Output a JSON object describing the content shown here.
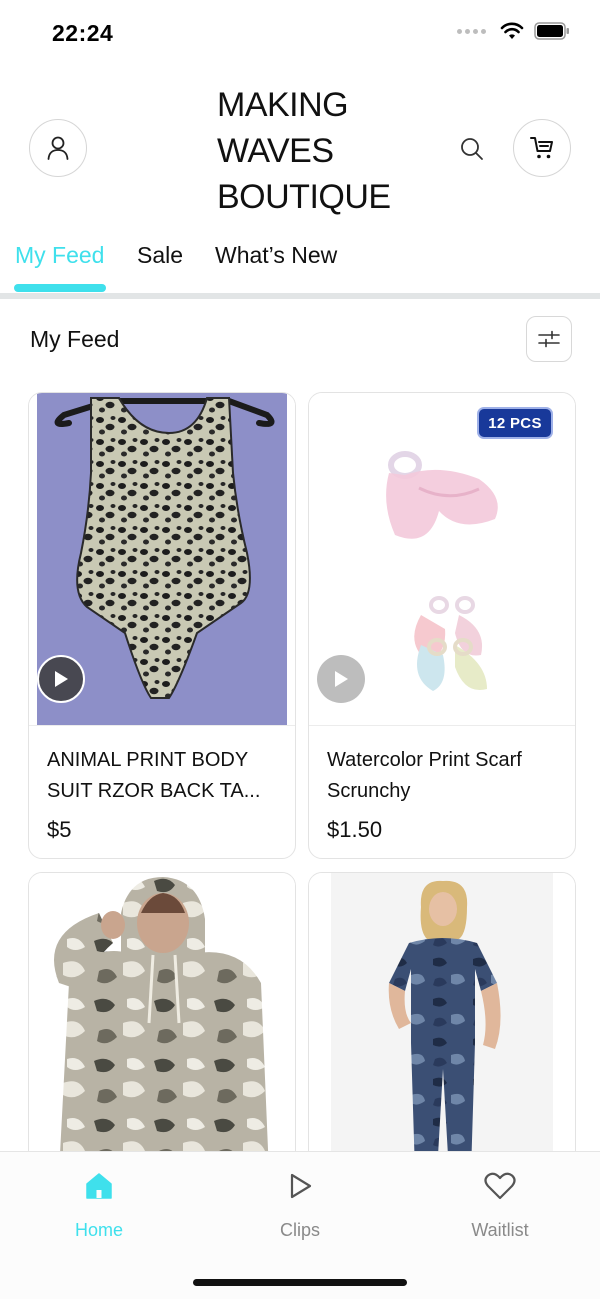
{
  "status": {
    "time": "22:24"
  },
  "header": {
    "title_lines": [
      "MAKING",
      "WAVES",
      "BOUTIQUE"
    ],
    "profile_icon": "person-icon",
    "search_icon": "search-icon",
    "cart_icon": "cart-icon"
  },
  "tabs": [
    {
      "label": "My Feed",
      "active": true
    },
    {
      "label": "Sale",
      "active": false
    },
    {
      "label": "What’s New",
      "active": false
    }
  ],
  "section": {
    "title": "My Feed",
    "filter_icon": "sliders-icon"
  },
  "products": [
    {
      "name": "ANIMAL PRINT BODY SUIT RZOR BACK TA...",
      "price": "$5",
      "badge": ""
    },
    {
      "name": "Watercolor Print Scarf Scrunchy",
      "price": "$1.50",
      "badge": "12 PCS"
    },
    {
      "name": "",
      "price": "",
      "badge": ""
    },
    {
      "name": "",
      "price": "",
      "badge": ""
    }
  ],
  "bottom_nav": [
    {
      "label": "Home",
      "icon": "home-icon",
      "active": true
    },
    {
      "label": "Clips",
      "icon": "play-icon",
      "active": false
    },
    {
      "label": "Waitlist",
      "icon": "heart-icon",
      "active": false
    }
  ],
  "colors": {
    "accent": "#3fe0ec",
    "text": "#111111",
    "inactive": "#8a8a8a"
  }
}
